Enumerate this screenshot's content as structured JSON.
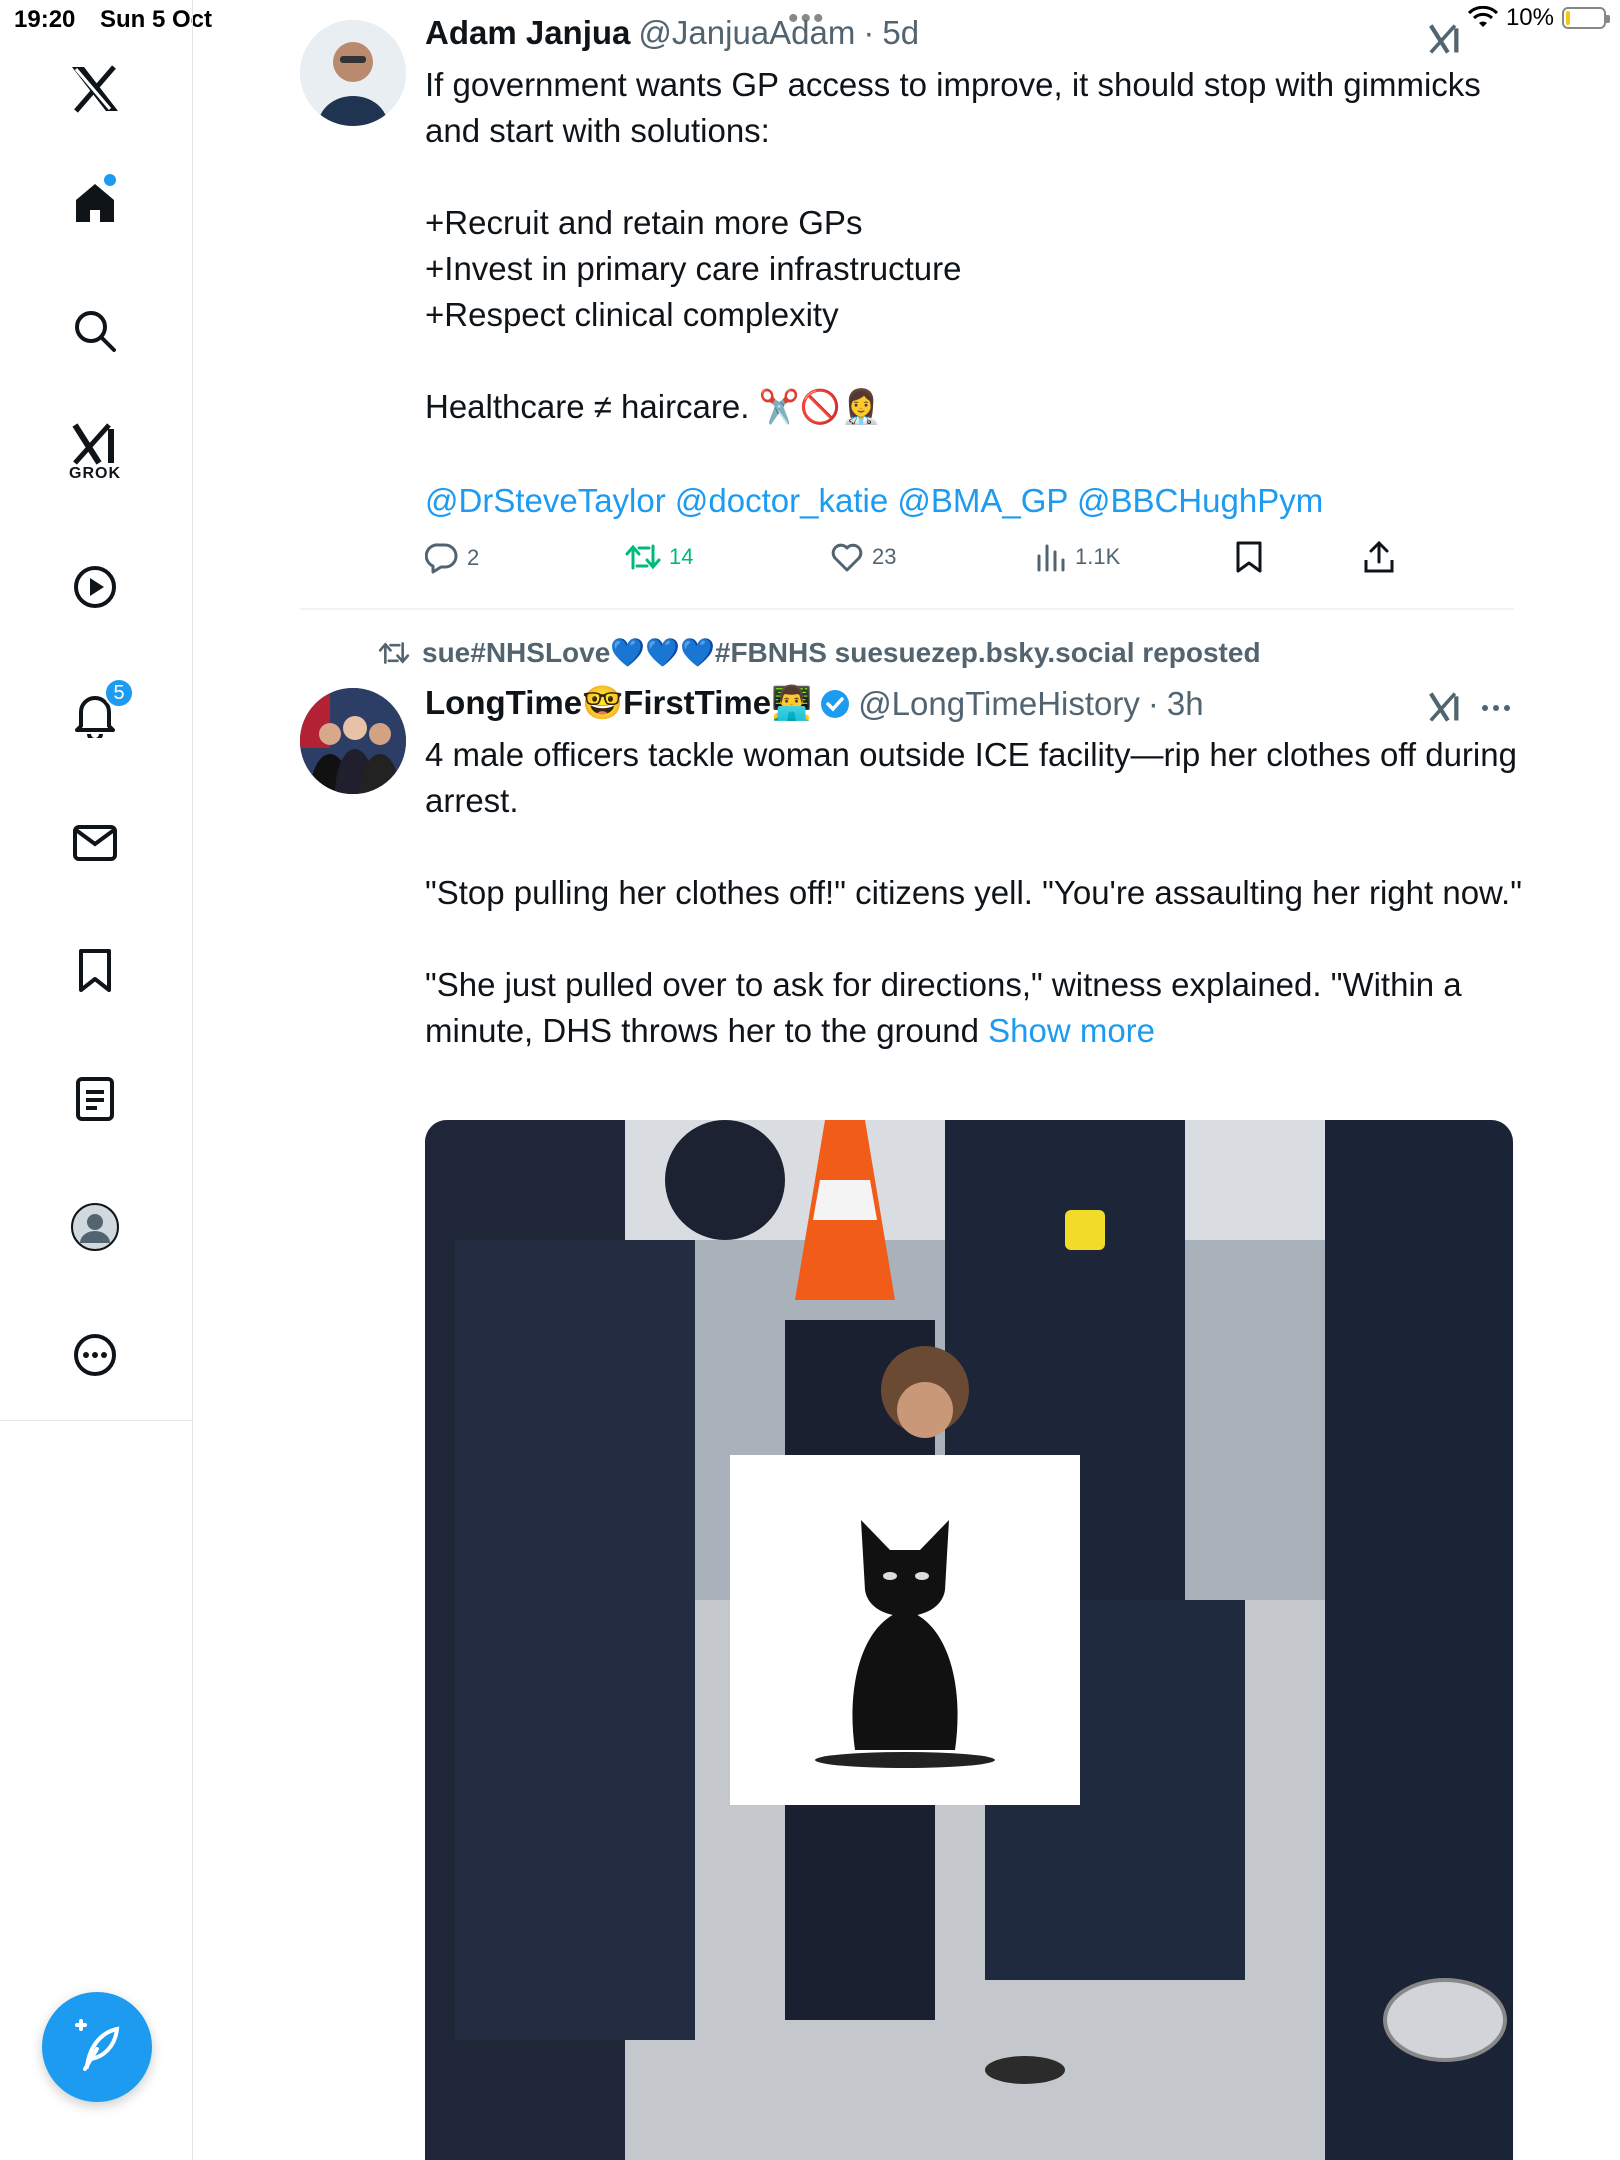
{
  "status_bar": {
    "time": "19:20",
    "date": "Sun 5 Oct",
    "battery": "10%",
    "battery_level": 0.1
  },
  "sidebar": {
    "items": [
      {
        "name": "x-logo"
      },
      {
        "name": "home"
      },
      {
        "name": "search"
      },
      {
        "name": "grok",
        "label": "GROK"
      },
      {
        "name": "videos"
      },
      {
        "name": "notifications",
        "badge": "5"
      },
      {
        "name": "messages"
      },
      {
        "name": "bookmarks"
      },
      {
        "name": "lists"
      },
      {
        "name": "profile"
      },
      {
        "name": "more"
      }
    ]
  },
  "tweet1": {
    "name": "Adam Janjua",
    "handle": "@JanjuaAdam",
    "sep": "·",
    "time": "5d",
    "text": "If government wants GP access to improve, it should stop with gimmicks and start with solutions:\n\n+Recruit and retain more GPs\n+Invest in primary care infrastructure\n+Respect clinical complexity\n\nHealthcare ≠ haircare. ✂️🚫👩‍⚕️",
    "mentions": "@DrSteveTaylor @doctor_katie @BMA_GP @BBCHughPym",
    "replies": "2",
    "reposts": "14",
    "likes": "23",
    "views": "1.1K"
  },
  "tweet2": {
    "repost_by": "sue#NHSLove💙💙💙#FBNHS suesuezep.bsky.social reposted",
    "name_part1": "LongTime",
    "name_emoji1": "🤓",
    "name_part2": "FirstTime",
    "name_emoji2": "👨‍💻",
    "handle": "@LongTimeHistory",
    "sep": "·",
    "time": "3h",
    "text": "4 male officers tackle woman outside ICE facility—rip her clothes off during arrest.\n\n\"Stop pulling her clothes off!\" citizens yell. \"You're assaulting her right now.\"\n\n\"She just pulled over to ask for directions,\" witness explained. \"Within a minute, DHS throws her to the ground ",
    "show_more": "Show more"
  },
  "colors": {
    "accent": "#1d9bf0",
    "repost_green": "#00ba7c",
    "muted": "#536471"
  }
}
